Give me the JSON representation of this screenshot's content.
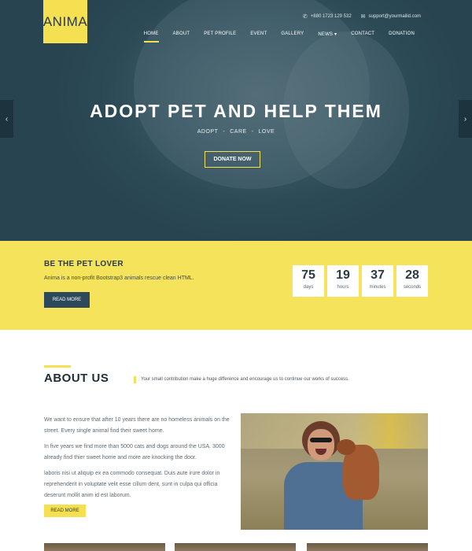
{
  "brand": {
    "logo_text": "ANIMA",
    "accent": "#f4e051",
    "dark": "#2c4a5b"
  },
  "contact": {
    "phone": "+880 1723 129 532",
    "email": "support@yourmailid.com",
    "phone_icon": "phone-icon",
    "email_icon": "mail-icon"
  },
  "nav": {
    "items": [
      {
        "label": "HOME",
        "active": true
      },
      {
        "label": "ABOUT"
      },
      {
        "label": "PET PROFILE"
      },
      {
        "label": "EVENT"
      },
      {
        "label": "GALLERY"
      },
      {
        "label": "NEWS ▾"
      },
      {
        "label": "CONTACT"
      },
      {
        "label": "DONATION"
      }
    ]
  },
  "hero": {
    "title": "ADOPT PET AND HELP THEM",
    "sub": [
      "ADOPT",
      "CARE",
      "LOVE"
    ],
    "sub_sep": "-",
    "button": "DONATE NOW",
    "prev_arrow": "‹",
    "next_arrow": "›"
  },
  "lover": {
    "title": "BE THE PET LOVER",
    "text": "Anima is a non-profit Bootstrap3 animals rescue clean HTML.",
    "button": "READ MORE",
    "counters": [
      {
        "value": "75",
        "label": "days"
      },
      {
        "value": "19",
        "label": "hours"
      },
      {
        "value": "37",
        "label": "minutes"
      },
      {
        "value": "28",
        "label": "seconds"
      }
    ]
  },
  "about": {
    "title": "ABOUT US",
    "tagline": "Your small contribution make a huge difference and encourage us to continue our works of success.",
    "paragraphs": [
      "We want to ensure that after 10 years there are no homeless animals on the street. Every single animal find their sweet home.",
      "In five years we find more than 5000 cats and dogs around the USA. 3000 already find thier sweet home and more are knocking the door.",
      "laboris nisi ut aliquip ex ea commodo consequat. Duis aute irure dolor in reprehenderit in voluptate velit esse cillum dent, sunt in culpa qui officia deserunt mollit anim id est laborum."
    ],
    "button": "READ MORE"
  }
}
